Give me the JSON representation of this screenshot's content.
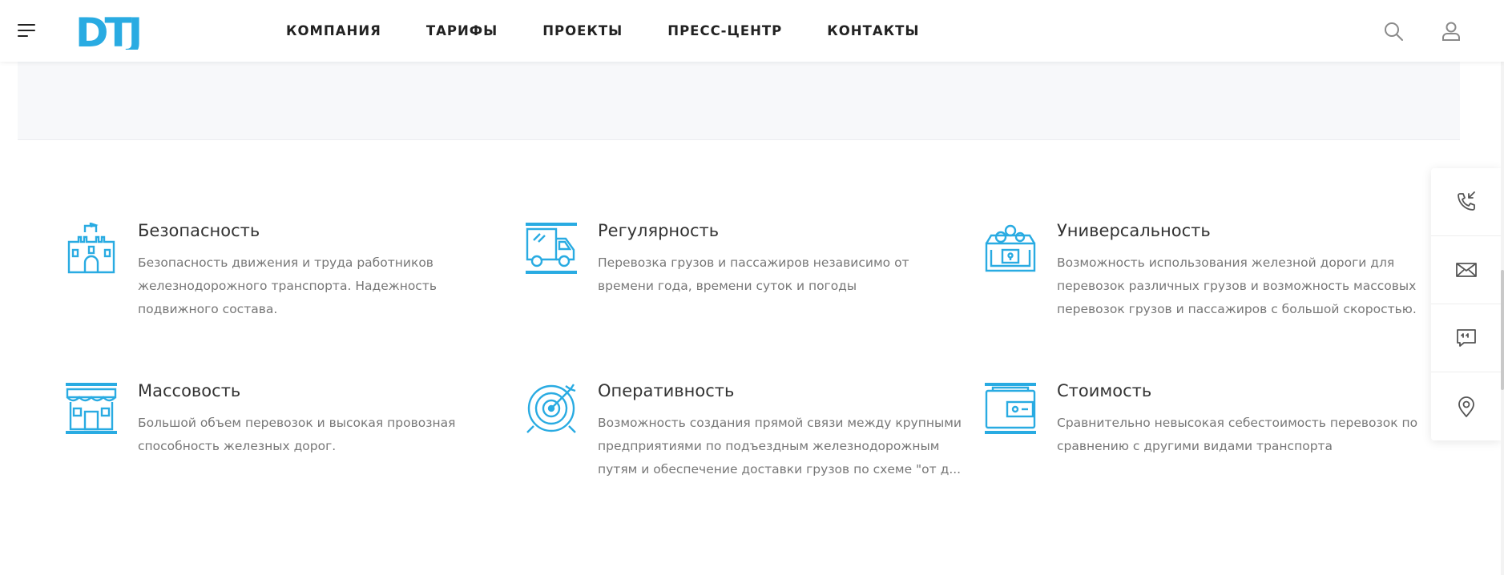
{
  "header": {
    "logo_text": "DTJ",
    "nav": [
      {
        "label": "КОМПАНИЯ"
      },
      {
        "label": "ТАРИФЫ"
      },
      {
        "label": "ПРОЕКТЫ"
      },
      {
        "label": "ПРЕСС-ЦЕНТР"
      },
      {
        "label": "КОНТАКТЫ"
      }
    ],
    "icons": {
      "menu": "burger-menu-icon",
      "search": "search-icon",
      "user": "user-icon"
    }
  },
  "features": [
    {
      "icon": "castle-icon",
      "title": "Безопасность",
      "text": "Безопасность движения и труда работников железнодорожного транспорта. Надежность подвижного состава."
    },
    {
      "icon": "truck-icon",
      "title": "Регулярность",
      "text": "Перевозка грузов и пассажиров независимо от времени года, времени суток и погоды"
    },
    {
      "icon": "treasure-chest-icon",
      "title": "Универсальность",
      "text": "Возможность использования железной дороги для перевозок различных грузов и возможность массовых перевозок грузов и пассажиров с большой скоростью."
    },
    {
      "icon": "store-icon",
      "title": "Массовость",
      "text": "Большой объем перевозок и высокая провозная способность железных дорог."
    },
    {
      "icon": "target-icon",
      "title": "Оперативность",
      "text": "Возможность создания прямой связи между крупными предприятиями по подъездным железнодорожным путям и обеспечение доставки грузов по схеме \"от д..."
    },
    {
      "icon": "wallet-icon",
      "title": "Стоимость",
      "text": "Сравнительно невысокая себестоимость перевозок по сравнению с другими видами транспорта"
    }
  ],
  "sidebar": {
    "items": [
      "phone-callback-icon",
      "mail-icon",
      "chat-icon",
      "location-pin-icon"
    ]
  },
  "colors": {
    "accent": "#29abe2",
    "text_dark": "#333333",
    "text_muted": "#777777"
  }
}
